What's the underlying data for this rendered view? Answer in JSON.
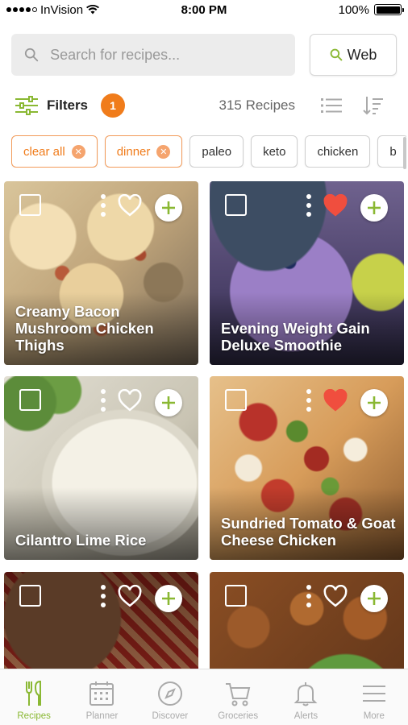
{
  "status_bar": {
    "carrier": "InVision",
    "time": "8:00 PM",
    "battery": "100%",
    "signal_bars": 4
  },
  "search": {
    "placeholder": "Search for recipes...",
    "web_label": "Web"
  },
  "filters": {
    "label": "Filters",
    "count": "1",
    "recipe_count": "315 Recipes"
  },
  "chips": [
    {
      "label": "clear all",
      "active": true
    },
    {
      "label": "dinner",
      "active": true
    },
    {
      "label": "paleo",
      "active": false
    },
    {
      "label": "keto",
      "active": false
    },
    {
      "label": "chicken",
      "active": false
    },
    {
      "label": "b",
      "active": false
    }
  ],
  "recipes": [
    {
      "title": "Creamy Bacon Mushroom Chicken Thighs",
      "favorited": false
    },
    {
      "title": "Evening Weight Gain Deluxe Smoothie",
      "favorited": true
    },
    {
      "title": "Cilantro Lime Rice",
      "favorited": false
    },
    {
      "title": "Sundried Tomato & Goat Cheese Chicken",
      "favorited": true
    },
    {
      "title": "",
      "favorited": false
    },
    {
      "title": "",
      "favorited": false
    }
  ],
  "tabs": [
    {
      "label": "Recipes",
      "icon": "fork-knife-icon",
      "active": true
    },
    {
      "label": "Planner",
      "icon": "calendar-icon",
      "active": false
    },
    {
      "label": "Discover",
      "icon": "compass-icon",
      "active": false
    },
    {
      "label": "Groceries",
      "icon": "cart-icon",
      "active": false
    },
    {
      "label": "Alerts",
      "icon": "bell-icon",
      "active": false
    },
    {
      "label": "More",
      "icon": "menu-icon",
      "active": false
    }
  ],
  "colors": {
    "accent_green": "#8ab833",
    "accent_orange": "#f07c1b",
    "heart_red": "#f04e3e"
  }
}
